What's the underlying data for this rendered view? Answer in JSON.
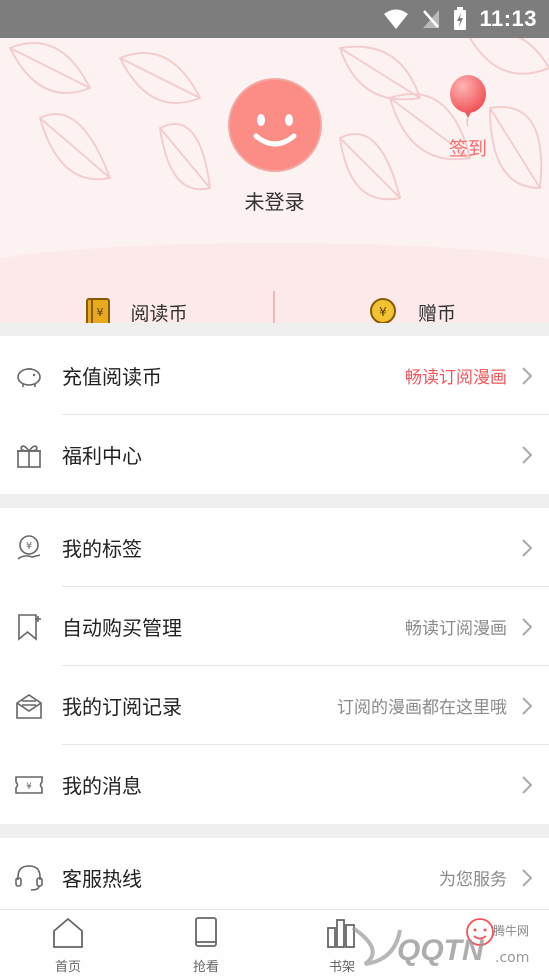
{
  "status_bar": {
    "time": "11:13"
  },
  "header": {
    "login_label": "未登录",
    "checkin_label": "签到"
  },
  "wallet": {
    "read_coin": "阅读币",
    "gift_coin": "赠币"
  },
  "menu_group_1": [
    {
      "title": "充值阅读币",
      "hint": "畅读订阅漫画",
      "icon": "piggy-bank-icon"
    },
    {
      "title": "福利中心",
      "hint": "",
      "icon": "gift-icon"
    }
  ],
  "menu_group_2": [
    {
      "title": "我的标签",
      "hint": "",
      "icon": "coin-hand-icon"
    },
    {
      "title": "自动购买管理",
      "hint": "畅读订阅漫画",
      "icon": "bookmark-icon"
    },
    {
      "title": "我的订阅记录",
      "hint": "订阅的漫画都在这里哦",
      "icon": "mail-icon"
    },
    {
      "title": "我的消息",
      "hint": "",
      "icon": "ticket-icon"
    }
  ],
  "menu_group_3": [
    {
      "title": "客服热线",
      "hint": "为您服务",
      "icon": "headset-icon"
    }
  ],
  "tabbar": {
    "home": "首页",
    "read": "抢看",
    "shelf": "书架"
  },
  "watermark": {
    "site": "QQTN",
    "domain": ".com",
    "cn": "腾牛网"
  },
  "colors": {
    "accent": "#f0575b",
    "avatar": "#fb8c86",
    "header_bg": "#fdf2f2"
  }
}
